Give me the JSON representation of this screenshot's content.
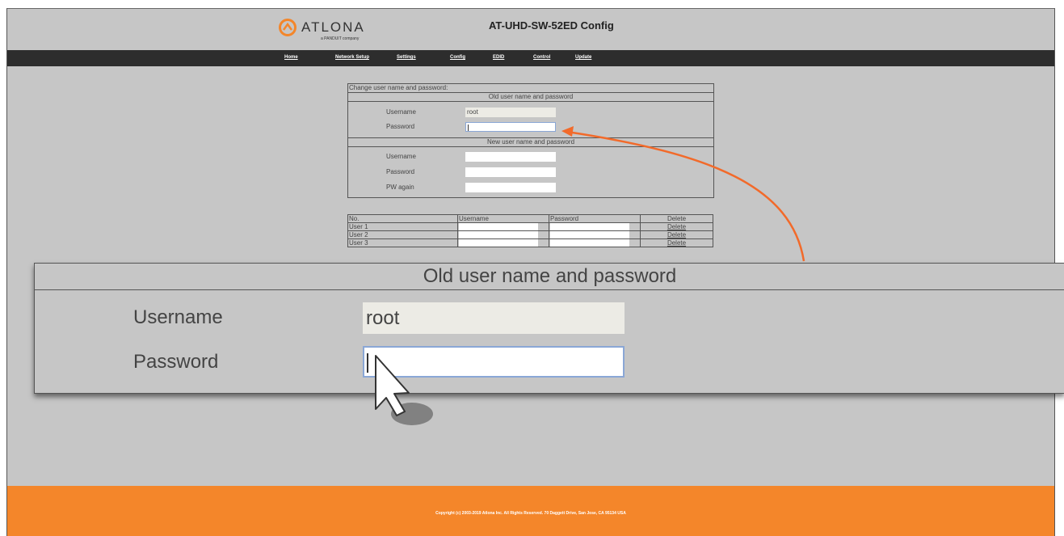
{
  "brand": {
    "name": "ATLONA",
    "tagline": "a PANDUIT company",
    "color": "#f4862a"
  },
  "header": {
    "title": "AT-UHD-SW-52ED Config"
  },
  "nav": [
    {
      "label": "Home"
    },
    {
      "label": "Network Setup"
    },
    {
      "label": "Settings"
    },
    {
      "label": "Config"
    },
    {
      "label": "EDID"
    },
    {
      "label": "Control"
    },
    {
      "label": "Update"
    }
  ],
  "credentials_form": {
    "caption": "Change user name and password:",
    "old_section": "Old user name and password",
    "new_section": "New user name and password",
    "old": {
      "username_label": "Username",
      "username_value": "root",
      "password_label": "Password",
      "password_value": ""
    },
    "new": {
      "username_label": "Username",
      "username_value": "",
      "password_label": "Password",
      "password_value": "",
      "pw_again_label": "PW again",
      "pw_again_value": ""
    }
  },
  "users_table": {
    "headers": [
      "No.",
      "Username",
      "Password",
      "Delete"
    ],
    "rows": [
      {
        "no": "User 1",
        "username": "",
        "password": "",
        "delete": "Delete"
      },
      {
        "no": "User 2",
        "username": "",
        "password": "",
        "delete": "Delete"
      },
      {
        "no": "User 3",
        "username": "",
        "password": "",
        "delete": "Delete"
      }
    ]
  },
  "zoom_callout": {
    "section": "Old user name and password",
    "username_label": "Username",
    "username_value": "root",
    "password_label": "Password"
  },
  "footer": {
    "copyright": "Copyright (c) 2003-2019 Atlona Inc. All Rights Reserved. 70 Daggett Drive, San Jose, CA 95134 USA"
  },
  "icons": [
    "atlona-logo-icon",
    "mouse-pointer-icon",
    "callout-arrow-icon"
  ]
}
